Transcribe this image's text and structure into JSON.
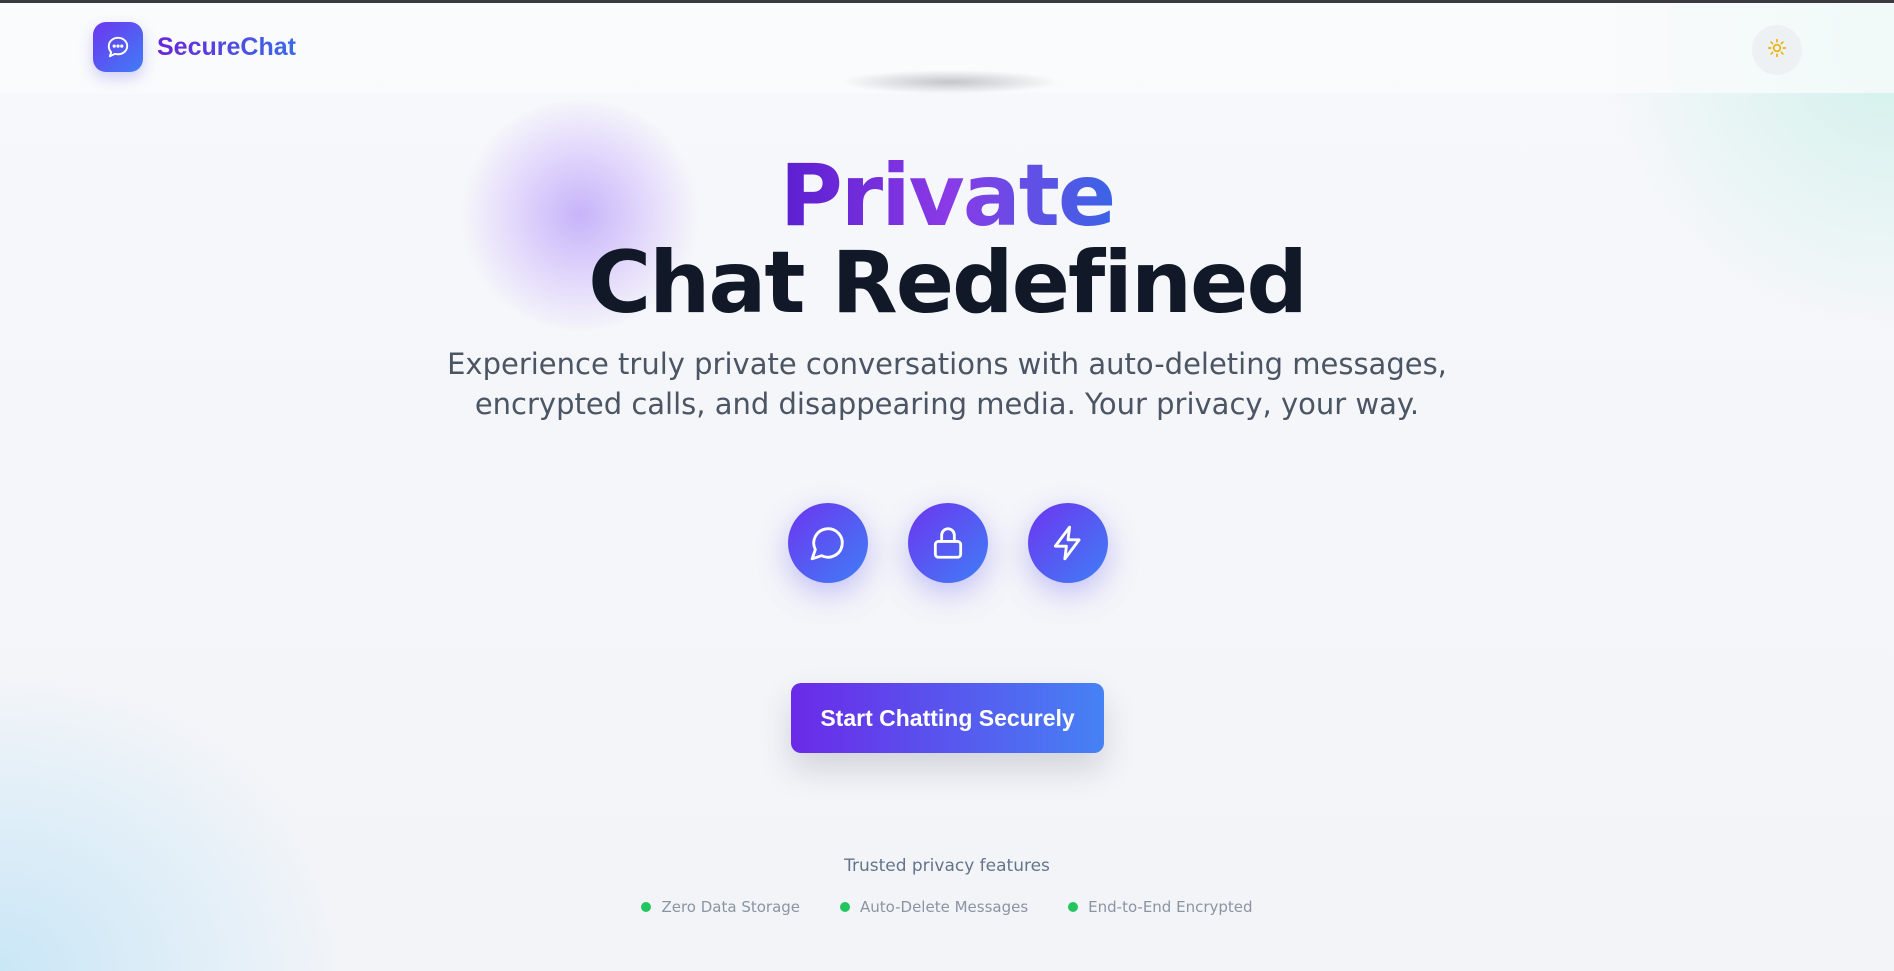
{
  "header": {
    "brand_name": "SecureChat",
    "logo_icon": "chat-bubble-dots-icon",
    "theme_toggle_icon": "sun-icon"
  },
  "hero": {
    "headline_accent": "Private",
    "headline_main": "Chat Redefined",
    "subtitle": "Experience truly private conversations with auto-deleting messages, encrypted calls, and disappearing media. Your privacy, your way."
  },
  "feature_icons": [
    "message-circle-icon",
    "lock-icon",
    "lightning-bolt-icon"
  ],
  "cta": {
    "label": "Start Chatting Securely"
  },
  "trust": {
    "heading": "Trusted privacy features",
    "items": [
      "Zero Data Storage",
      "Auto-Delete Messages",
      "End-to-End Encrypted"
    ]
  },
  "colors": {
    "brand_gradient_start": "#6d35f0",
    "brand_gradient_end": "#3f7ef5",
    "status_dot": "#22c55e",
    "sun_icon": "#eab308"
  }
}
